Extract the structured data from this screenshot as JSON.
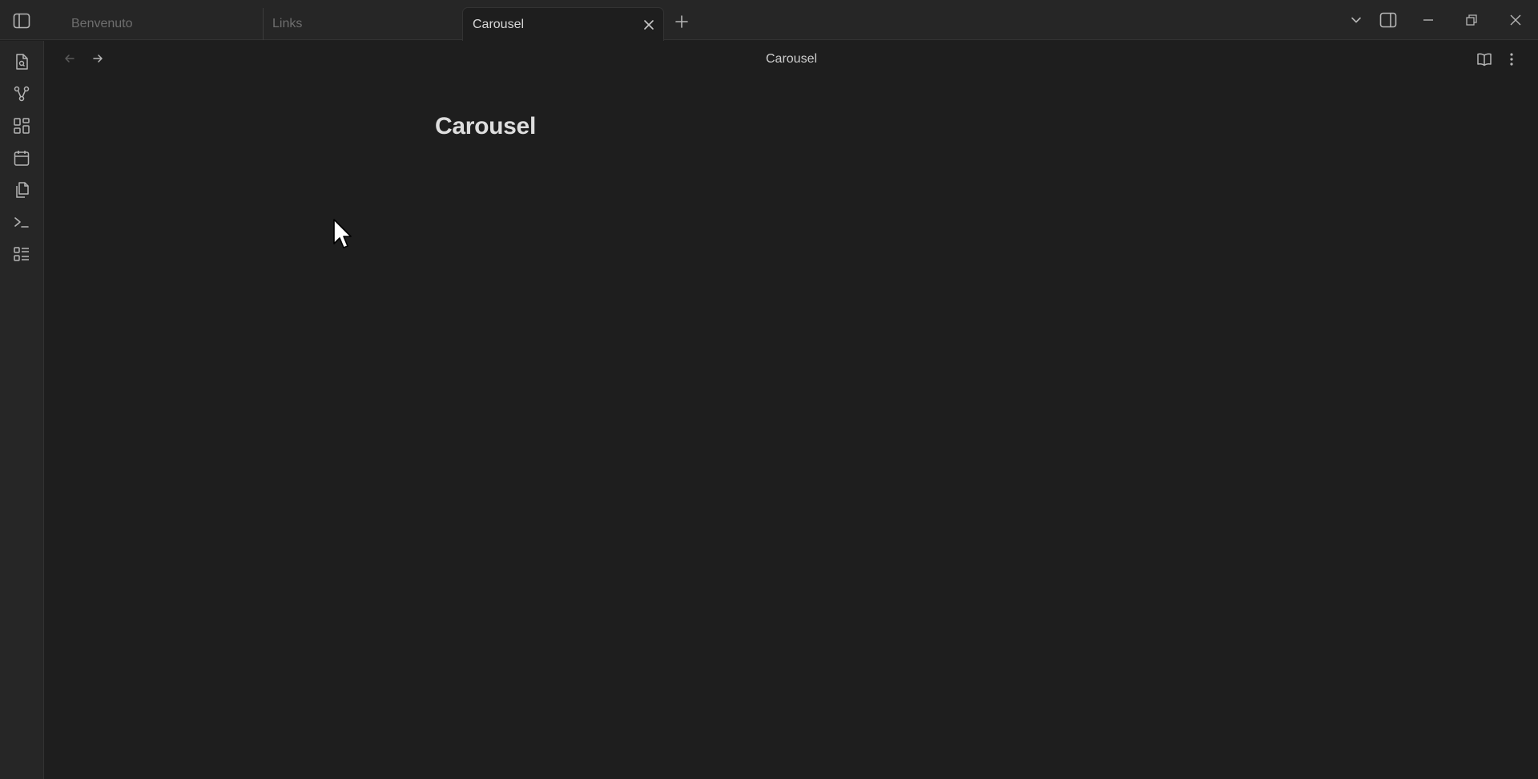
{
  "tabs": [
    {
      "label": "Benvenuto",
      "active": false
    },
    {
      "label": "Links",
      "active": false
    },
    {
      "label": "Carousel",
      "active": true
    }
  ],
  "view": {
    "header_title": "Carousel",
    "note_title": "Carousel"
  },
  "icons": {
    "sidebar_toggle": "sidebar-toggle-icon",
    "tab_close": "close-icon",
    "new_tab": "plus-icon",
    "tab_list": "chevron-down-icon",
    "right_sidebar": "right-sidebar-icon",
    "minimize": "minimize-icon",
    "restore": "restore-icon",
    "close_window": "close-icon",
    "ribbon": [
      "quick-switcher-icon",
      "graph-view-icon",
      "canvas-icon",
      "daily-note-icon",
      "templates-icon",
      "command-palette-icon",
      "outline-icon"
    ],
    "back": "arrow-left-icon",
    "forward": "arrow-right-icon",
    "reading_view": "book-open-icon",
    "more_options": "more-vertical-icon"
  },
  "colors": {
    "background": "#1e1e1e",
    "chrome": "#262626",
    "text_active": "#dadada",
    "text_muted": "#6e6e6e"
  }
}
